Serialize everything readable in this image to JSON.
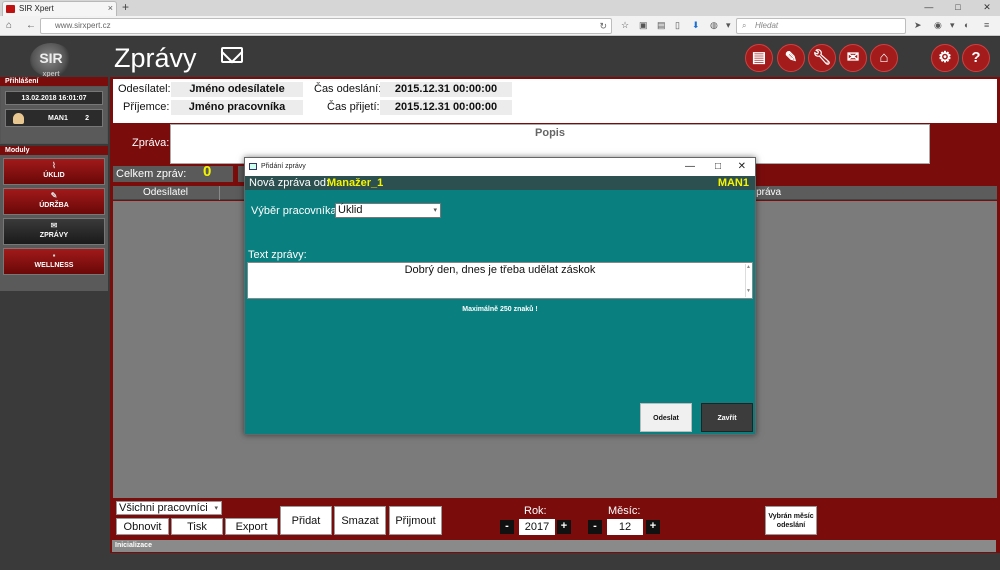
{
  "browser": {
    "tab_title": "SIR Xpert",
    "tab_close": "×",
    "new_tab": "+",
    "url": "www.sirxpert.cz",
    "search_placeholder": "Hledat",
    "window_controls": [
      "—",
      "□",
      "✕"
    ]
  },
  "app": {
    "logo_text": "SIR",
    "logo_sub": "xpert",
    "title": "Zprávy",
    "top_icons": [
      "document-icon",
      "clipboard-icon",
      "wrench-icon",
      "mail-icon",
      "bell-icon",
      "gear-icon",
      "help-icon"
    ],
    "help_glyph": "?"
  },
  "sidebar": {
    "login_header": "Přihlášení",
    "datetime": "13.02.2018 16:01:07",
    "user_name": "MAN1",
    "user_count": "2",
    "modules_header": "Moduly",
    "modules": [
      {
        "label": "ÚKLID",
        "icon": "broom-icon",
        "style": "red"
      },
      {
        "label": "ÚDRŽBA",
        "icon": "wrench-icon",
        "style": "red"
      },
      {
        "label": "ZPRÁVY",
        "icon": "mail-icon",
        "style": "dark"
      },
      {
        "label": "WELLNESS",
        "icon": "spa-icon",
        "style": "red"
      }
    ]
  },
  "header": {
    "sender_label": "Odesílatel:",
    "sender_value": "Jméno odesílatele",
    "receiver_label": "Příjemce:",
    "receiver_value": "Jméno pracovníka",
    "sent_label": "Čas odeslání:",
    "sent_value": "2015.12.31 00:00:00",
    "received_label": "Čas přijetí:",
    "received_value": "2015.12.31 00:00:00",
    "message_label": "Zpráva:",
    "popis": "Popis"
  },
  "list": {
    "total_label": "Celkem zpráv:",
    "total_value": "0",
    "columns": [
      "Odesílatel",
      "Zpráva"
    ]
  },
  "bottom": {
    "filter_value": "Všichni pracovníci",
    "buttons": [
      "Obnovit",
      "Tisk",
      "Export",
      "Přidat",
      "Smazat",
      "Přijmout"
    ],
    "year_label": "Rok:",
    "year_value": "2017",
    "month_label": "Měsíc:",
    "month_value": "12",
    "minus": "-",
    "plus": "+",
    "month_selected_btn": "Vybrán měsíc odeslání",
    "status": "Inicializace"
  },
  "dialog": {
    "title": "Přidání zprávy",
    "from_label": "Nová zpráva od:",
    "from_value": "Manažer_1",
    "from_code": "MAN1",
    "worker_label": "Výběr pracovníka:",
    "worker_value": "Úklid",
    "text_label": "Text zprávy:",
    "text_value": "Dobrý den, dnes je třeba udělat záskok",
    "max_note": "Maximálně 250 znaků !",
    "send": "Odeslat",
    "close": "Zavřít"
  },
  "colors": {
    "accent_red": "#7a0c0c",
    "dialog_teal": "#0a7f7f",
    "highlight_yellow": "#f5f500"
  }
}
